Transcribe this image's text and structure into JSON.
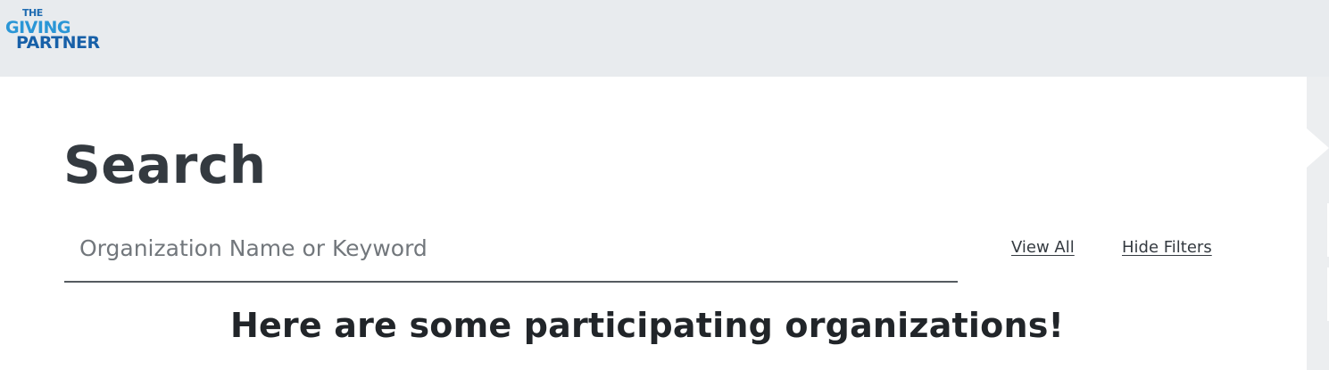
{
  "header": {
    "logo": {
      "line1": "THE",
      "line2": "GIVING",
      "line3": "PARTNER"
    }
  },
  "search": {
    "title": "Search",
    "placeholder": "Organization Name or Keyword",
    "value": "",
    "view_all_label": "View All",
    "hide_filters_label": "Hide Filters"
  },
  "results": {
    "heading": "Here are some participating organizations!"
  },
  "colors": {
    "header_bg": "#e8ebee",
    "logo_light_blue": "#2a96d6",
    "logo_dark_blue": "#1760a8",
    "title_text": "#343a40",
    "content_bg": "#ffffff"
  }
}
